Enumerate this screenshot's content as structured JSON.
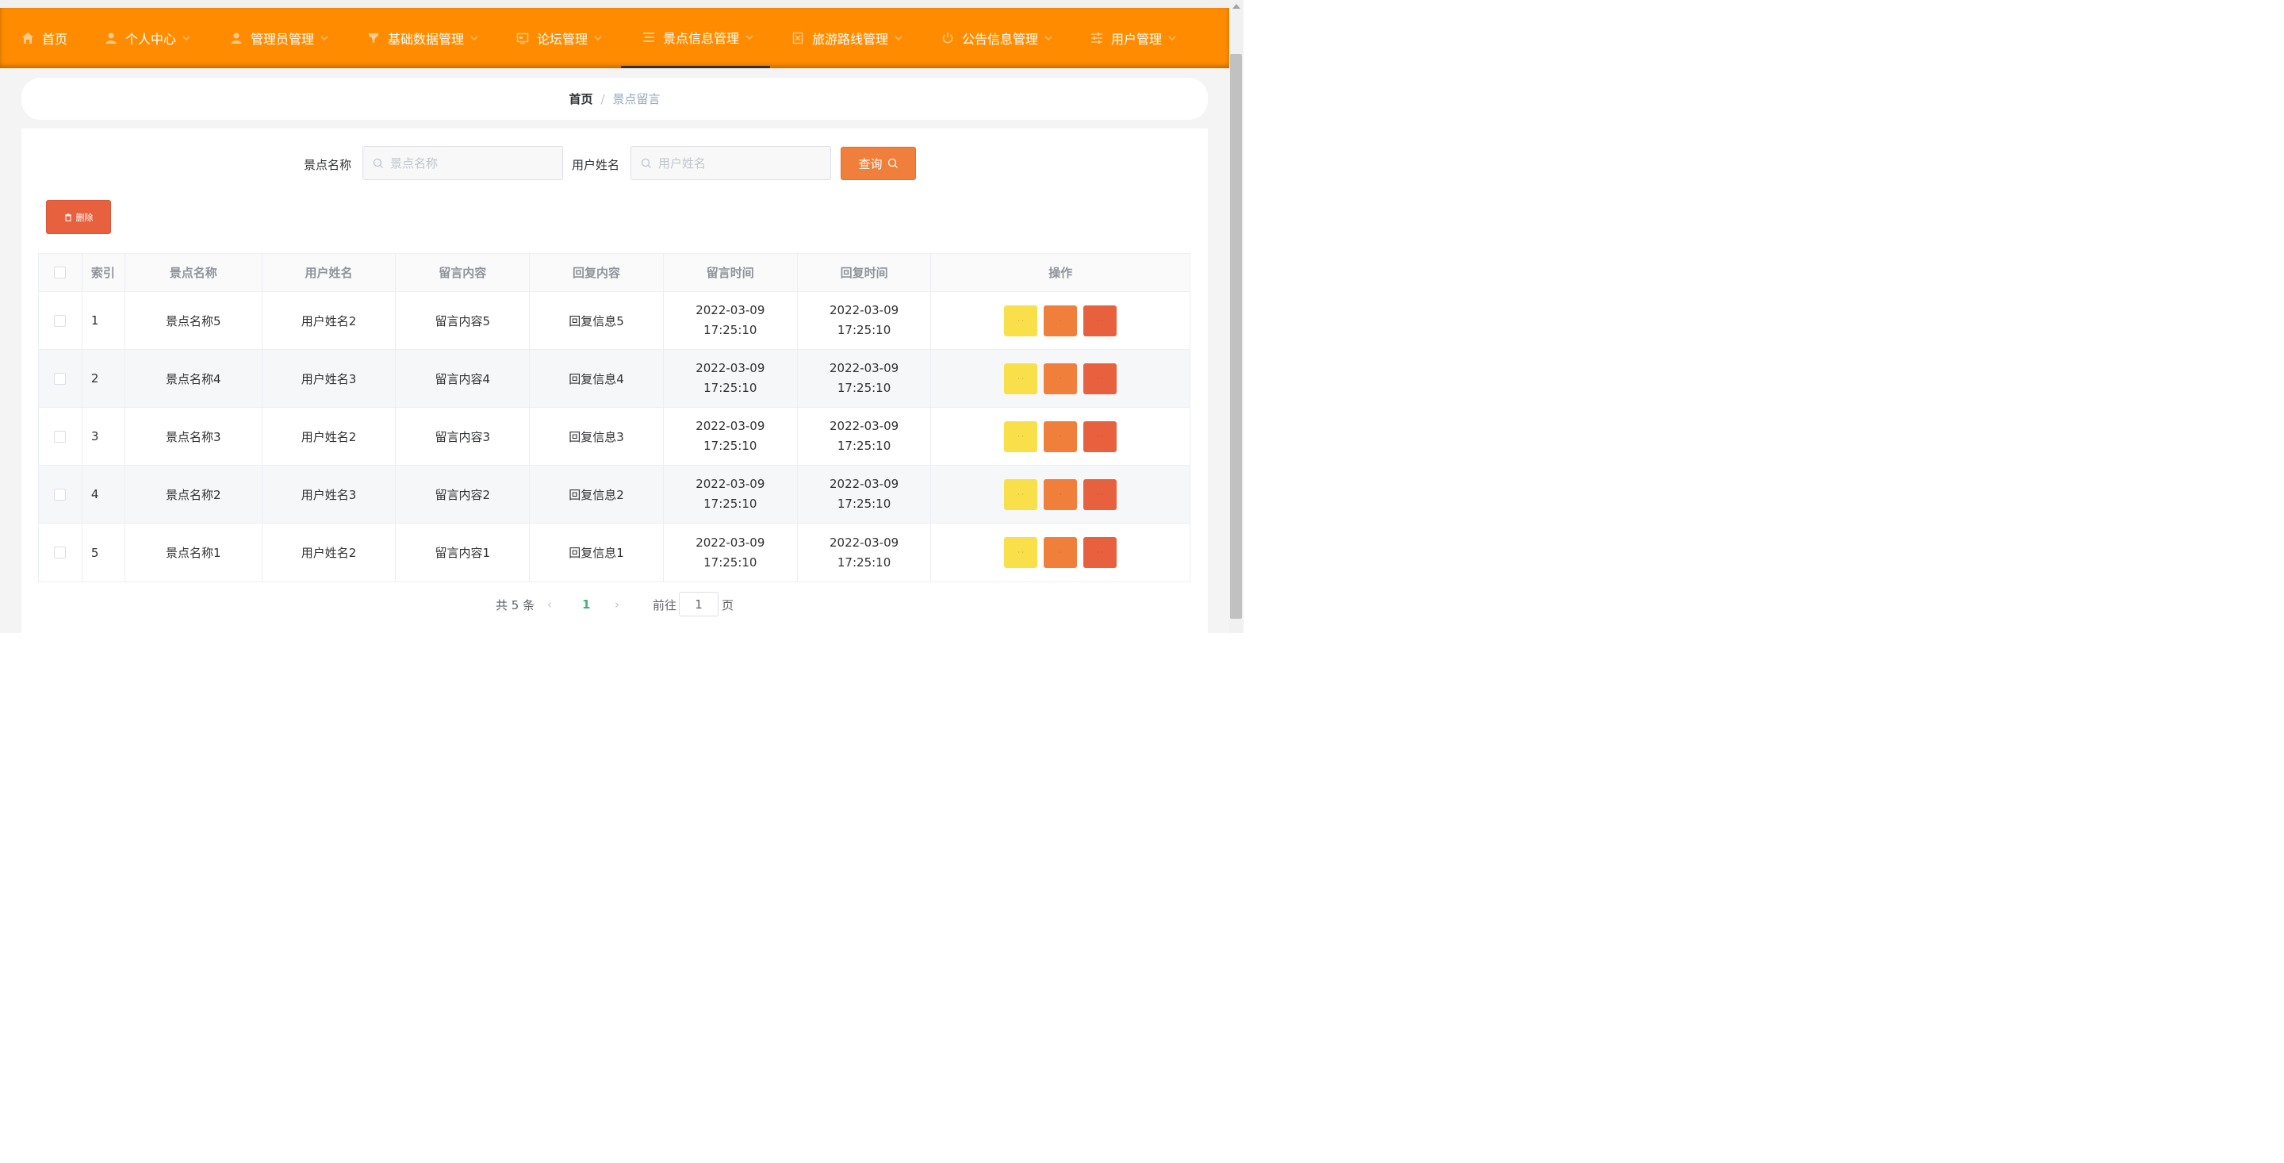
{
  "nav": {
    "items": [
      {
        "label": "首页",
        "icon": "home-icon"
      },
      {
        "label": "个人中心",
        "icon": "user-icon"
      },
      {
        "label": "管理员管理",
        "icon": "user-icon"
      },
      {
        "label": "基础数据管理",
        "icon": "funnel-icon"
      },
      {
        "label": "论坛管理",
        "icon": "screen-icon"
      },
      {
        "label": "景点信息管理",
        "icon": "list-icon"
      },
      {
        "label": "旅游路线管理",
        "icon": "document-icon"
      },
      {
        "label": "公告信息管理",
        "icon": "power-icon"
      },
      {
        "label": "用户管理",
        "icon": "sliders-icon"
      }
    ],
    "active": "景点信息管理",
    "bar_color": "#ff8c00"
  },
  "breadcrumb": {
    "home": "首页",
    "separator": "/",
    "current": "景点留言"
  },
  "search": {
    "spot_label": "景点名称",
    "spot_placeholder": "景点名称",
    "user_label": "用户姓名",
    "user_placeholder": "用户姓名",
    "query_label": "查询"
  },
  "toolbar": {
    "delete_label": "删除"
  },
  "table": {
    "headers": [
      "索引",
      "景点名称",
      "用户姓名",
      "留言内容",
      "回复内容",
      "留言时间",
      "回复时间",
      "操作"
    ],
    "rows": [
      {
        "index": "1",
        "spot": "景点名称5",
        "user": "用户姓名2",
        "message": "留言内容5",
        "reply": "回复信息5",
        "msg_time": "2022-03-09 17:25:10",
        "reply_time": "2022-03-09 17:25:10"
      },
      {
        "index": "2",
        "spot": "景点名称4",
        "user": "用户姓名3",
        "message": "留言内容4",
        "reply": "回复信息4",
        "msg_time": "2022-03-09 17:25:10",
        "reply_time": "2022-03-09 17:25:10"
      },
      {
        "index": "3",
        "spot": "景点名称3",
        "user": "用户姓名2",
        "message": "留言内容3",
        "reply": "回复信息3",
        "msg_time": "2022-03-09 17:25:10",
        "reply_time": "2022-03-09 17:25:10"
      },
      {
        "index": "4",
        "spot": "景点名称2",
        "user": "用户姓名3",
        "message": "留言内容2",
        "reply": "回复信息2",
        "msg_time": "2022-03-09 17:25:10",
        "reply_time": "2022-03-09 17:25:10"
      },
      {
        "index": "5",
        "spot": "景点名称1",
        "user": "用户姓名2",
        "message": "留言内容1",
        "reply": "回复信息1",
        "msg_time": "2022-03-09 17:25:10",
        "reply_time": "2022-03-09 17:25:10"
      }
    ],
    "action_colors": [
      "#f9e04b",
      "#f07f3c",
      "#e8613f"
    ]
  },
  "pagination": {
    "total_text": "共 5 条",
    "current_page": "1",
    "goto_label": "前往",
    "goto_value": "1",
    "page_suffix": "页"
  }
}
